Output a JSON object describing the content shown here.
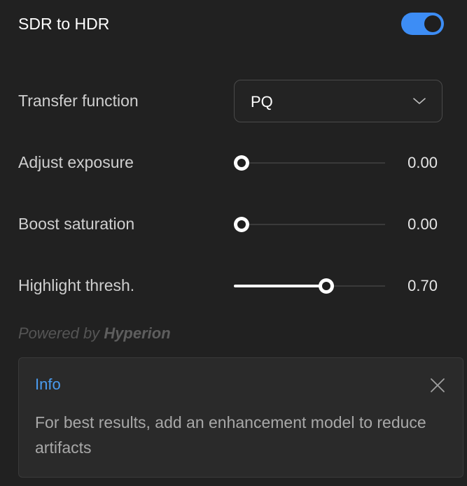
{
  "panel": {
    "title": "SDR to HDR",
    "enabled": true
  },
  "transfer": {
    "label": "Transfer function",
    "selected": "PQ"
  },
  "sliders": [
    {
      "label": "Adjust exposure",
      "value_text": "0.00",
      "fraction": 0.05
    },
    {
      "label": "Boost saturation",
      "value_text": "0.00",
      "fraction": 0.05
    },
    {
      "label": "Highlight thresh.",
      "value_text": "0.70",
      "fraction": 0.61
    }
  ],
  "powered": {
    "prefix": "Powered by",
    "brand": "Hyperion"
  },
  "info": {
    "title": "Info",
    "message": "For best results, add an enhancement model to reduce artifacts"
  },
  "colors": {
    "accent": "#3d8df5",
    "info_title": "#4a9cf0",
    "background": "#212121"
  }
}
